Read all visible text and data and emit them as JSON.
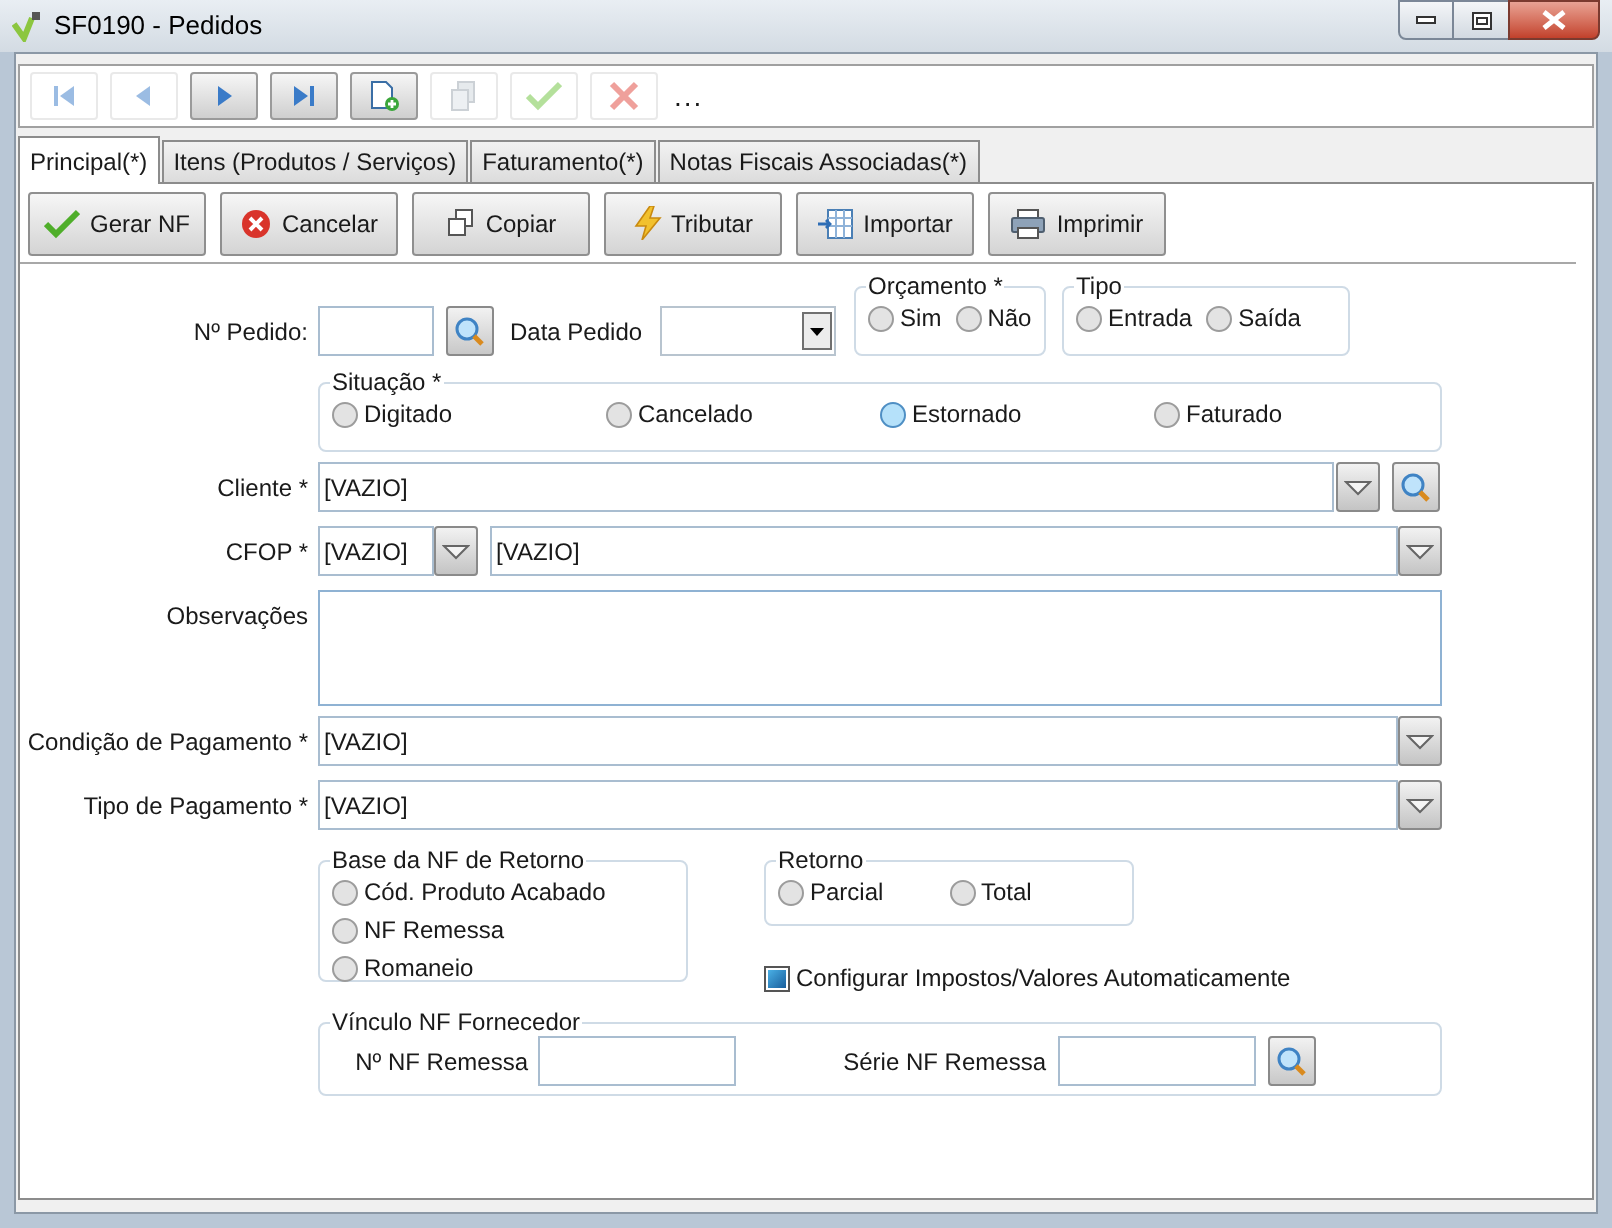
{
  "window": {
    "title": "SF0190 - Pedidos"
  },
  "toolbar": {
    "buttons": [
      {
        "kind": "first",
        "disabled": true
      },
      {
        "kind": "prev",
        "disabled": true
      },
      {
        "kind": "next",
        "disabled": false
      },
      {
        "kind": "last",
        "disabled": false
      },
      {
        "kind": "new",
        "disabled": false
      },
      {
        "kind": "copy",
        "disabled": true
      },
      {
        "kind": "confirm",
        "disabled": true
      },
      {
        "kind": "cancel",
        "disabled": true
      }
    ],
    "more": "..."
  },
  "tabs": [
    {
      "label": "Principal(*)",
      "selected": true
    },
    {
      "label": "Itens (Produtos / Serviços)",
      "selected": false
    },
    {
      "label": "Faturamento(*)",
      "selected": false
    },
    {
      "label": "Notas Fiscais Associadas(*)",
      "selected": false
    }
  ],
  "actions": [
    {
      "kind": "check",
      "label": "Gerar NF"
    },
    {
      "kind": "cancel",
      "label": "Cancelar"
    },
    {
      "kind": "copy",
      "label": "Copiar"
    },
    {
      "kind": "lightning",
      "label": "Tributar"
    },
    {
      "kind": "import",
      "label": "Importar"
    },
    {
      "kind": "print",
      "label": "Imprimir"
    }
  ],
  "form": {
    "pedido": {
      "label": "Nº Pedido:"
    },
    "data_pedido": {
      "label": "Data Pedido"
    },
    "orcamento": {
      "title": "Orçamento *",
      "options": [
        {
          "label": "Sim",
          "selected": false
        },
        {
          "label": "Não",
          "selected": false
        }
      ]
    },
    "tipo": {
      "title": "Tipo",
      "options": [
        {
          "label": "Entrada",
          "selected": false
        },
        {
          "label": "Saída",
          "selected": false
        }
      ]
    },
    "situacao": {
      "title": "Situação *",
      "options": [
        {
          "label": "Digitado",
          "selected": false
        },
        {
          "label": "Cancelado",
          "selected": false
        },
        {
          "label": "Estornado",
          "selected": true
        },
        {
          "label": "Faturado",
          "selected": false
        }
      ]
    },
    "cliente": {
      "label": "Cliente *",
      "value": "[VAZIO]"
    },
    "cfop": {
      "label": "CFOP *",
      "code": "[VAZIO]",
      "description": "[VAZIO]"
    },
    "observacoes": {
      "label": "Observações"
    },
    "condicao_pagamento": {
      "label": "Condição de Pagamento *",
      "value": "[VAZIO]"
    },
    "tipo_pagamento": {
      "label": "Tipo de Pagamento *",
      "value": "[VAZIO]"
    },
    "base_nf_retorno": {
      "title": "Base da NF de Retorno",
      "options": [
        {
          "label": "Cód. Produto Acabado",
          "selected": false
        },
        {
          "label": "NF Remessa",
          "selected": false
        },
        {
          "label": "Romaneio",
          "selected": false
        }
      ]
    },
    "retorno": {
      "title": "Retorno",
      "options": [
        {
          "label": "Parcial",
          "selected": false
        },
        {
          "label": "Total",
          "selected": false
        }
      ]
    },
    "configurar_impostos": {
      "label": "Configurar Impostos/Valores Automaticamente",
      "checked": true
    },
    "vinculo": {
      "title": "Vínculo NF Fornecedor",
      "nf_remessa_label": "Nº NF Remessa",
      "serie_label": "Série NF Remessa"
    }
  }
}
